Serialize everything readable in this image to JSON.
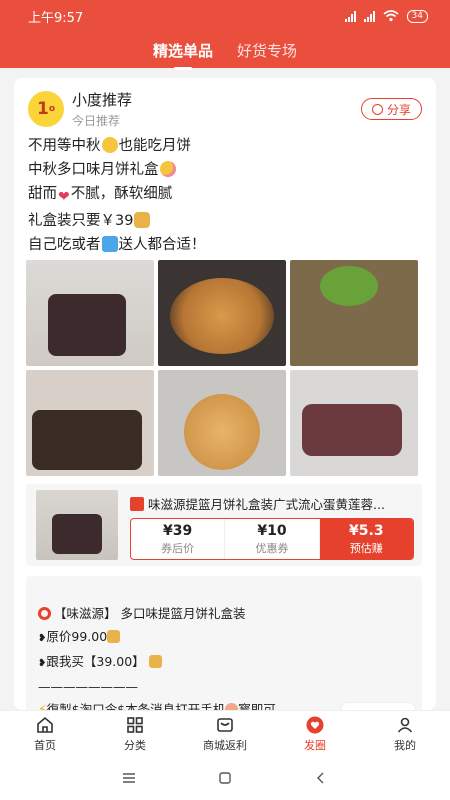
{
  "status_bar": {
    "time": "上午9:57",
    "battery": "34"
  },
  "header": {
    "tabs": [
      {
        "label": "精选单品"
      },
      {
        "label": "好货专场"
      }
    ]
  },
  "post": {
    "author": "小度推荐",
    "subtitle": "今日推荐",
    "share_label": "分享",
    "lines": [
      {
        "before": "不用等中秋",
        "after": "也能吃月饼"
      },
      {
        "before": "中秋多口味月饼礼盒",
        "after": ""
      },
      {
        "before": "甜而",
        "after": "不腻，酥软细腻"
      },
      {
        "before": "礼盒装只要￥39",
        "after": ""
      },
      {
        "before": "自己吃或者",
        "after": "送人都合适！"
      }
    ]
  },
  "product": {
    "title": "味滋源提篮月饼礼盒装广式流心蛋黄莲蓉...",
    "prices": [
      {
        "value": "¥39",
        "label": "券后价"
      },
      {
        "value": "¥10",
        "label": "优惠券"
      },
      {
        "value": "¥5.3",
        "label": "预估赚"
      }
    ]
  },
  "description": {
    "lines": [
      "【味滋源】 多口味提篮月饼礼盒装",
      "原价99.00",
      "跟我买【39.00】",
      "————————",
      "復製$淘口令$本条消息打开手机",
      "寳即可"
    ]
  },
  "bottom_nav": [
    {
      "label": "首页",
      "icon": "home-icon"
    },
    {
      "label": "分类",
      "icon": "grid-icon"
    },
    {
      "label": "商城返利",
      "icon": "store-icon"
    },
    {
      "label": "发圈",
      "icon": "heart-icon"
    },
    {
      "label": "我的",
      "icon": "user-icon"
    }
  ],
  "accent_color": "#e5412d"
}
